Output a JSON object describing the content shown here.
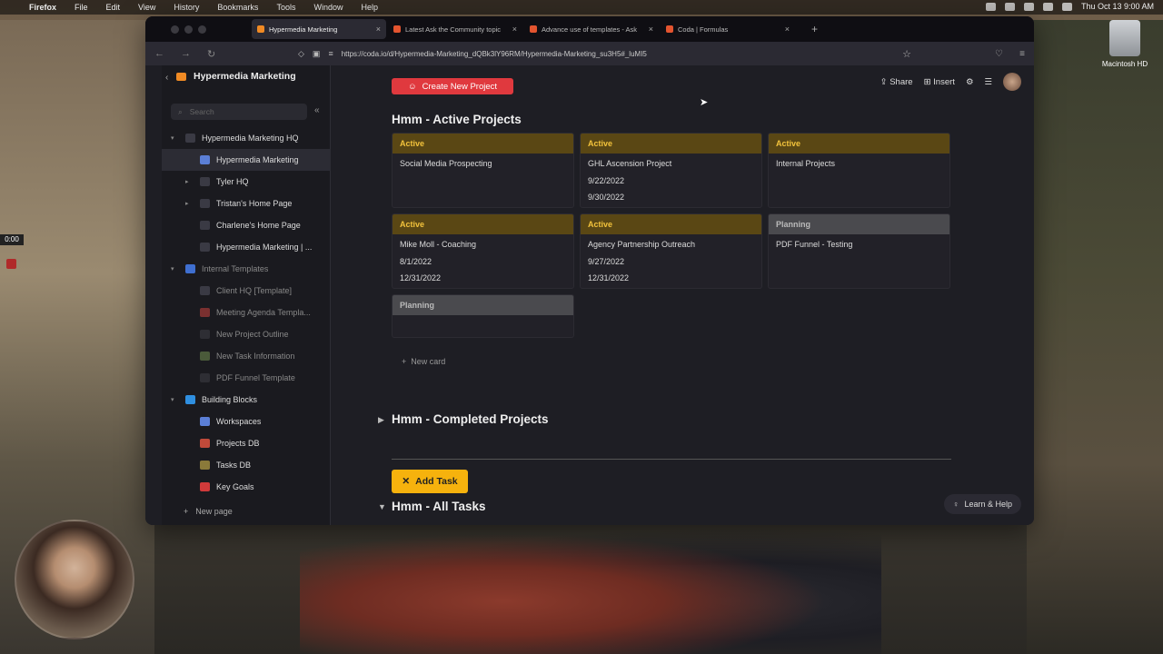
{
  "menubar": {
    "app": "Firefox",
    "items": [
      "File",
      "Edit",
      "View",
      "History",
      "Bookmarks",
      "Tools",
      "Window",
      "Help"
    ],
    "clock": "Thu Oct 13  9:00 AM"
  },
  "desktop": {
    "disk_label": "Macintosh HD",
    "timer": "0:00"
  },
  "browser": {
    "tabs": [
      {
        "title": "Hypermedia Marketing",
        "active": true
      },
      {
        "title": "Latest Ask the Community topic",
        "active": false
      },
      {
        "title": "Advance use of templates - Ask",
        "active": false
      },
      {
        "title": "Coda | Formulas",
        "active": false
      }
    ],
    "url": "https://coda.io/d/Hypermedia-Marketing_dQBk3lY96RM/Hypermedia-Marketing_su3H5#_luMI5"
  },
  "doc": {
    "name": "Hypermedia Marketing",
    "search_placeholder": "Search",
    "toolbar": {
      "share": "Share",
      "insert": "Insert"
    },
    "tree": [
      {
        "label": "Hypermedia Marketing HQ",
        "level": 0,
        "caret": "▾",
        "dim": false,
        "icon": "#3a3a44"
      },
      {
        "label": "Hypermedia Marketing",
        "level": 1,
        "caret": "",
        "dim": false,
        "sel": true,
        "icon": "#5b7fd6"
      },
      {
        "label": "Tyler HQ",
        "level": 1,
        "caret": "▸",
        "dim": false,
        "icon": "#3a3a44"
      },
      {
        "label": "Tristan's Home Page",
        "level": 1,
        "caret": "▸",
        "dim": false,
        "icon": "#3a3a44"
      },
      {
        "label": "Charlene's Home Page",
        "level": 1,
        "caret": "",
        "dim": false,
        "icon": "#3a3a44"
      },
      {
        "label": "Hypermedia Marketing | ...",
        "level": 1,
        "caret": "",
        "dim": false,
        "icon": "#3a3a44"
      },
      {
        "label": "Internal Templates",
        "level": 0,
        "caret": "▾",
        "dim": true,
        "icon": "#3f6fd0"
      },
      {
        "label": "Client HQ [Template]",
        "level": 1,
        "caret": "",
        "dim": true,
        "icon": "#3a3a44"
      },
      {
        "label": "Meeting Agenda Templa...",
        "level": 1,
        "caret": "",
        "dim": true,
        "icon": "#7a3030"
      },
      {
        "label": "New Project Outline",
        "level": 1,
        "caret": "",
        "dim": true,
        "icon": "#2e2e34"
      },
      {
        "label": "New Task Information",
        "level": 1,
        "caret": "",
        "dim": true,
        "icon": "#4a5a3a"
      },
      {
        "label": "PDF Funnel Template",
        "level": 1,
        "caret": "",
        "dim": true,
        "icon": "#2e2e34"
      },
      {
        "label": "Building Blocks",
        "level": 0,
        "caret": "▾",
        "dim": false,
        "icon": "#2f8fe0"
      },
      {
        "label": "Workspaces",
        "level": 1,
        "caret": "",
        "dim": false,
        "icon": "#5b7fd6"
      },
      {
        "label": "Projects DB",
        "level": 1,
        "caret": "",
        "dim": false,
        "icon": "#c04a3a"
      },
      {
        "label": "Tasks DB",
        "level": 1,
        "caret": "",
        "dim": false,
        "icon": "#8a7a3a"
      },
      {
        "label": "Key Goals",
        "level": 1,
        "caret": "",
        "dim": false,
        "icon": "#d03a3a"
      }
    ],
    "new_page": "New page",
    "create_button": "Create New Project",
    "active_heading": "Hmm - Active Projects",
    "cards": [
      {
        "status": "Active",
        "lines": [
          "Social Media Prospecting"
        ]
      },
      {
        "status": "Active",
        "lines": [
          "GHL Ascension Project",
          "9/22/2022",
          "9/30/2022"
        ]
      },
      {
        "status": "Active",
        "lines": [
          "Internal Projects"
        ]
      },
      {
        "status": "Active",
        "lines": [
          "Mike Moll - Coaching",
          "8/1/2022",
          "12/31/2022"
        ]
      },
      {
        "status": "Active",
        "lines": [
          "Agency Partnership Outreach",
          "9/27/2022",
          "12/31/2022"
        ]
      },
      {
        "status": "Planning",
        "lines": [
          "PDF Funnel - Testing"
        ]
      },
      {
        "status": "Planning",
        "lines": []
      }
    ],
    "new_card": "New card",
    "completed_heading": "Hmm - Completed Projects",
    "add_task": "Add Task",
    "all_tasks_heading": "Hmm - All Tasks",
    "help": "Learn & Help"
  }
}
